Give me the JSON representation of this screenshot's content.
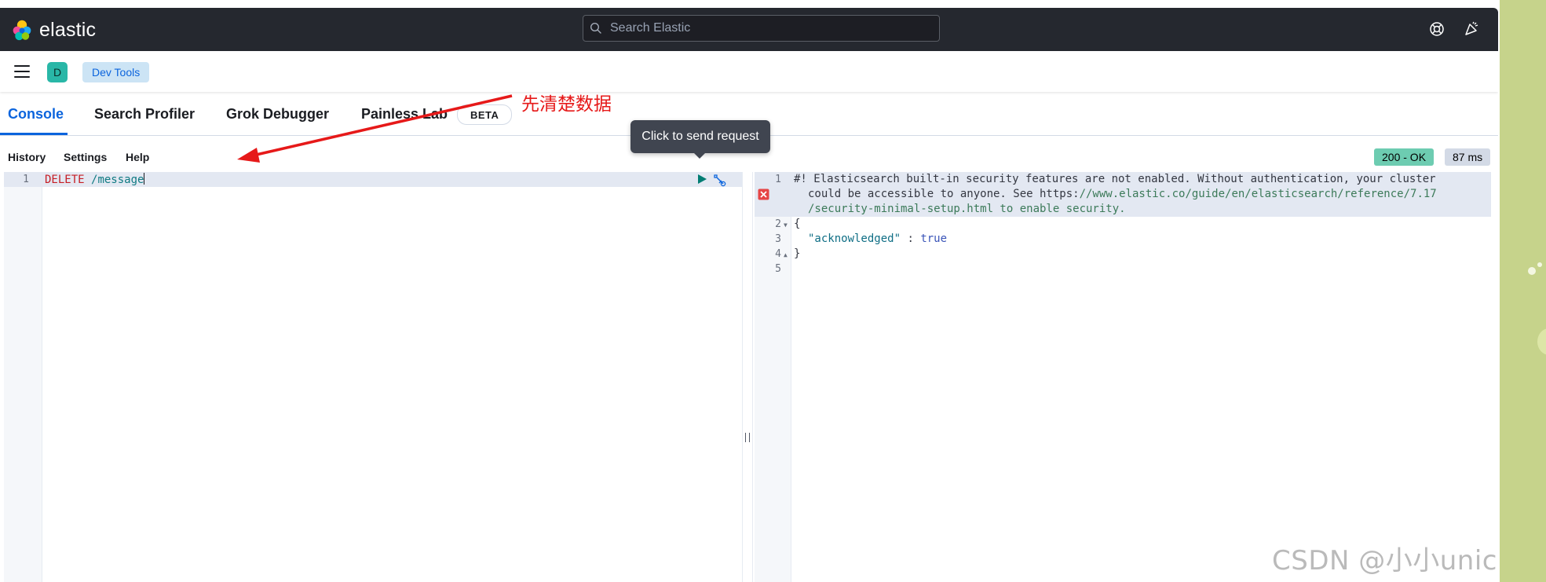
{
  "header": {
    "logo_text": "elastic",
    "search_placeholder": "Search Elastic"
  },
  "breadcrumb": {
    "space_initial": "D",
    "current": "Dev Tools"
  },
  "tabs": [
    {
      "label": "Console",
      "active": true
    },
    {
      "label": "Search Profiler",
      "active": false
    },
    {
      "label": "Grok Debugger",
      "active": false
    },
    {
      "label": "Painless Lab",
      "active": false
    }
  ],
  "beta_badge": "BETA",
  "toolbar": {
    "history": "History",
    "settings": "Settings",
    "help": "Help",
    "status": "200 - OK",
    "timing": "87 ms"
  },
  "tooltip": "Click to send request",
  "request": {
    "line_numbers": [
      "1"
    ],
    "method": "DELETE",
    "path": "/message"
  },
  "response": {
    "line_numbers": [
      "1",
      "2",
      "3",
      "4",
      "5"
    ],
    "comment_prefix": "#! Elasticsearch built-in security features are not enabled. Without authentication, your cluster",
    "comment_line2_a": "could be accessible to anyone. See https:",
    "comment_line2_b": "//www.elastic.co/guide/en/elasticsearch/reference/7.17",
    "comment_line3": "/security-minimal-setup.html to enable security.",
    "open_brace": "{",
    "key": "\"acknowledged\"",
    "separator": " : ",
    "value": "true",
    "close_brace": "}"
  },
  "annotation": "先清楚数据",
  "watermark": "CSDN @小小unicorn",
  "colors": {
    "header_bg": "#25282f",
    "accent": "#0b64dd",
    "status_ok": "#6dccb1",
    "annotation": "#e61919",
    "side_strip": "#c6d38b"
  },
  "icons": {
    "logo": "elastic-logo-icon",
    "search": "search-icon",
    "help": "help-lifebuoy-icon",
    "news": "newsfeed-icon",
    "menu": "hamburger-menu-icon",
    "send": "play-icon",
    "wrench": "wrench-icon",
    "error": "error-x-icon"
  }
}
